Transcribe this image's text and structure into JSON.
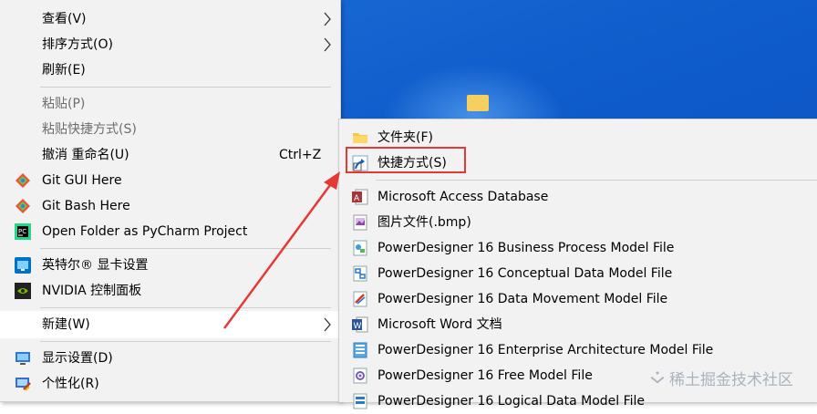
{
  "main_menu": {
    "items": [
      {
        "label": "查看(V)",
        "submenu": true,
        "icon": null
      },
      {
        "label": "排序方式(O)",
        "submenu": true,
        "icon": null
      },
      {
        "label": "刷新(E)",
        "icon": null
      },
      {
        "label": "粘贴(P)",
        "disabled": true,
        "icon": null
      },
      {
        "label": "粘贴快捷方式(S)",
        "disabled": true,
        "icon": null
      },
      {
        "label": "撤消 重命名(U)",
        "shortcut": "Ctrl+Z",
        "icon": null
      },
      {
        "label": "Git GUI Here",
        "icon": "git-diamond-icon"
      },
      {
        "label": "Git Bash Here",
        "icon": "git-diamond-icon"
      },
      {
        "label": "Open Folder as PyCharm Project",
        "icon": "pycharm-icon"
      },
      {
        "label": "英特尔® 显卡设置",
        "icon": "intel-graphics-icon"
      },
      {
        "label": "NVIDIA 控制面板",
        "icon": "nvidia-icon"
      },
      {
        "label": "新建(W)",
        "submenu": true,
        "highlighted": true,
        "icon": null
      },
      {
        "label": "显示设置(D)",
        "icon": "display-settings-icon"
      },
      {
        "label": "个性化(R)",
        "icon": "personalize-icon"
      }
    ]
  },
  "sub_menu": {
    "items": [
      {
        "label": "文件夹(F)",
        "icon": "folder-icon"
      },
      {
        "label": "快捷方式(S)",
        "icon": "shortcut-icon",
        "annotated": true
      },
      {
        "label": "Microsoft Access Database",
        "icon": "access-icon"
      },
      {
        "label": "图片文件(.bmp)",
        "icon": "bitmap-icon"
      },
      {
        "label": "PowerDesigner 16 Business Process Model File",
        "icon": "powerdesigner-bpm-icon"
      },
      {
        "label": "PowerDesigner 16 Conceptual Data Model File",
        "icon": "powerdesigner-cdm-icon"
      },
      {
        "label": "PowerDesigner 16 Data Movement Model File",
        "icon": "powerdesigner-dmm-icon"
      },
      {
        "label": "Microsoft Word 文档",
        "icon": "word-icon"
      },
      {
        "label": "PowerDesigner 16 Enterprise Architecture Model File",
        "icon": "powerdesigner-eam-icon"
      },
      {
        "label": "PowerDesigner 16 Free Model File",
        "icon": "powerdesigner-fem-icon"
      },
      {
        "label": "PowerDesigner 16 Logical Data Model File",
        "icon": "powerdesigner-ldm-icon"
      }
    ]
  },
  "annotation": {
    "color": "#e53935"
  },
  "watermark": {
    "text": "稀土掘金技术社区"
  },
  "colors": {
    "menu_bg": "#f2f2f2",
    "desktop": "#0f5ccc",
    "highlight": "#ffffff"
  }
}
